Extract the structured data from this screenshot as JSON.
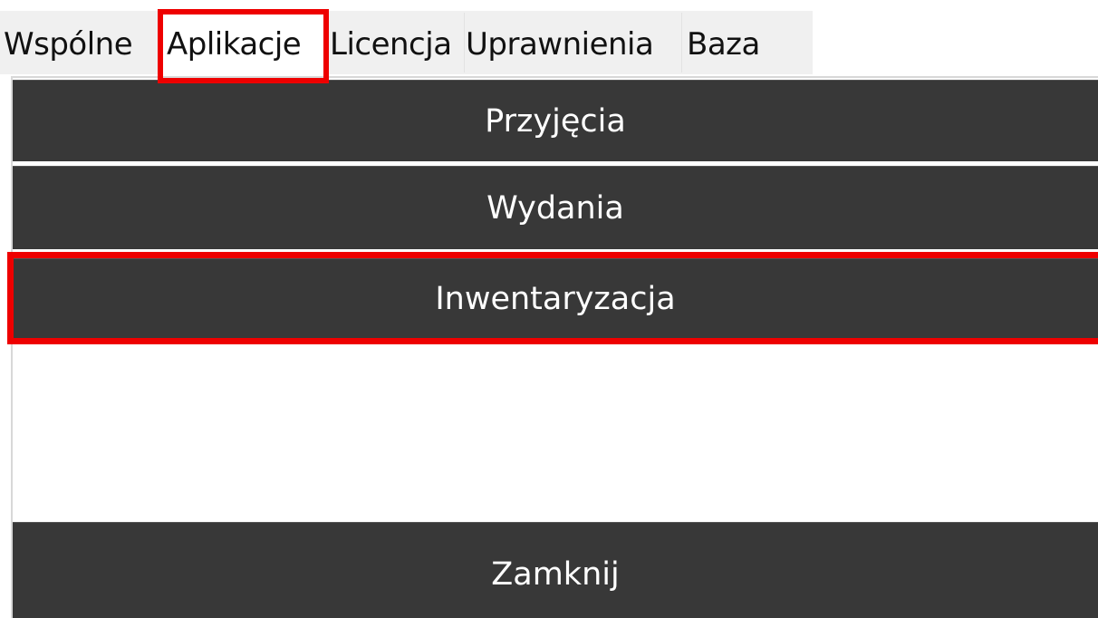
{
  "tabs": {
    "common": "Wspólne",
    "applications": "Aplikacje",
    "license": "Licencja",
    "permissions": "Uprawnienia",
    "database": "Baza"
  },
  "buttons": {
    "receipts": "Przyjęcia",
    "issues": "Wydania",
    "inventory": "Inwentaryzacja",
    "close": "Zamknij"
  },
  "colors": {
    "highlight": "#ee0000",
    "button_bg": "#383838",
    "button_text": "#ffffff",
    "tab_bg": "#f0f0f0",
    "tab_selected_bg": "#ffffff"
  }
}
